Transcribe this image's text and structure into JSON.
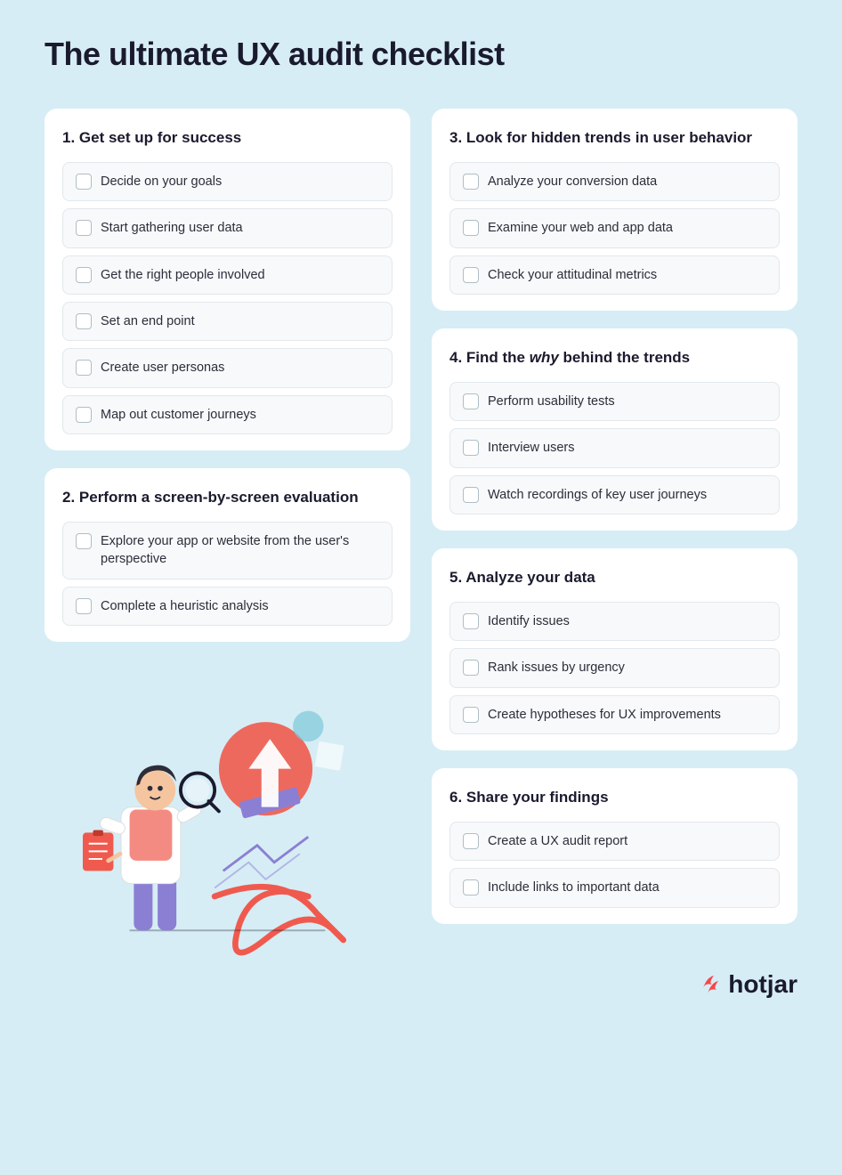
{
  "page": {
    "title": "The ultimate UX audit checklist"
  },
  "sections": {
    "left": [
      {
        "id": "section-1",
        "title": "1.  Get set up for success",
        "items": [
          "Decide on your goals",
          "Start gathering user data",
          "Get the right people involved",
          "Set an end point",
          "Create user personas",
          "Map out customer journeys"
        ]
      },
      {
        "id": "section-2",
        "title": "2.  Perform a screen-by-screen evaluation",
        "items": [
          "Explore your app or website from the user's perspective",
          "Complete a heuristic analysis"
        ]
      }
    ],
    "right": [
      {
        "id": "section-3",
        "title": "3.  Look for hidden trends in user behavior",
        "items": [
          "Analyze your conversion data",
          "Examine your web and app data",
          "Check your attitudinal metrics"
        ]
      },
      {
        "id": "section-4",
        "title_plain": "4.  Find the ",
        "title_italic": "why",
        "title_rest": " behind the trends",
        "items": [
          "Perform usability tests",
          "Interview users",
          "Watch recordings of key user journeys"
        ]
      },
      {
        "id": "section-5",
        "title": "5.  Analyze your data",
        "items": [
          "Identify issues",
          "Rank issues by urgency",
          "Create hypotheses for UX improvements"
        ]
      },
      {
        "id": "section-6",
        "title": "6.  Share your findings",
        "items": [
          "Create a UX audit report",
          "Include links to important data"
        ]
      }
    ]
  },
  "branding": {
    "logo_text": "hotjar",
    "icon": "⚡"
  }
}
